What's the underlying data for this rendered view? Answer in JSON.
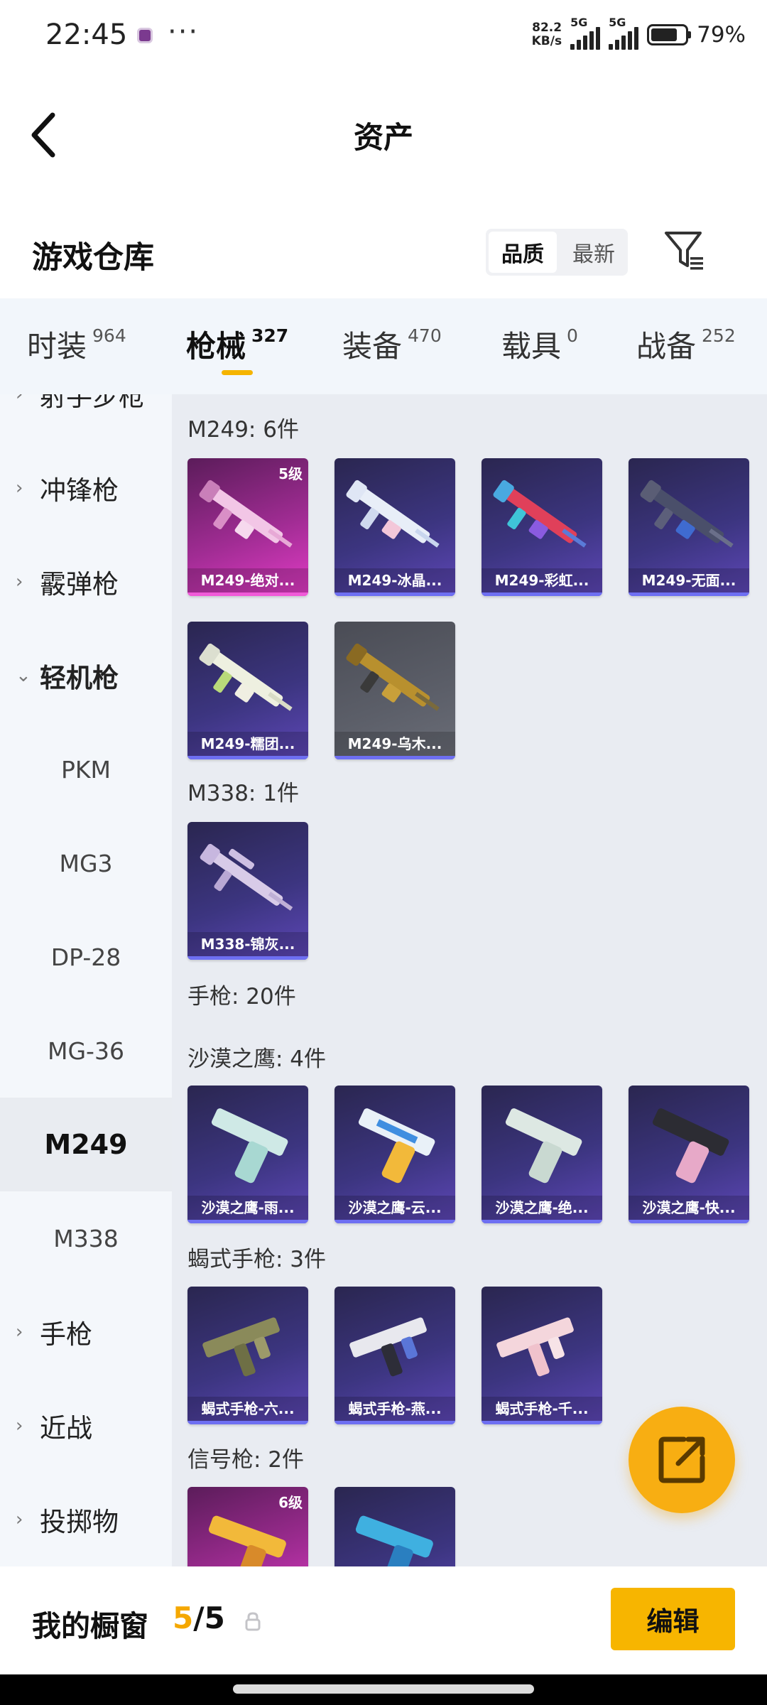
{
  "status_bar": {
    "time": "22:45",
    "speed_value": "82.2",
    "speed_unit": "KB/s",
    "network_1": "5G",
    "network_2": "5G",
    "battery_percent": "79%"
  },
  "header": {
    "title": "资产",
    "back_icon": "back-arrow-icon"
  },
  "warehouse": {
    "title": "游戏仓库",
    "sort_options": [
      "品质",
      "最新"
    ],
    "sort_selected": "品质",
    "filter_icon": "filter-icon"
  },
  "tabs": [
    {
      "name": "时装",
      "count": "964"
    },
    {
      "name": "枪械",
      "count": "327",
      "active": true
    },
    {
      "name": "装备",
      "count": "470"
    },
    {
      "name": "载具",
      "count": "0"
    },
    {
      "name": "战备",
      "count": "252"
    }
  ],
  "sidebar": {
    "partial_item": "射手步枪",
    "items": [
      {
        "label": "冲锋枪",
        "type": "category"
      },
      {
        "label": "霰弹枪",
        "type": "category"
      },
      {
        "label": "轻机枪",
        "type": "category",
        "expanded": true
      },
      {
        "label": "PKM",
        "type": "sub"
      },
      {
        "label": "MG3",
        "type": "sub"
      },
      {
        "label": "DP-28",
        "type": "sub"
      },
      {
        "label": "MG-36",
        "type": "sub"
      },
      {
        "label": "M249",
        "type": "sub",
        "selected": true
      },
      {
        "label": "M338",
        "type": "sub"
      },
      {
        "label": "手枪",
        "type": "category"
      },
      {
        "label": "近战",
        "type": "category"
      },
      {
        "label": "投掷物",
        "type": "category"
      }
    ]
  },
  "groups": {
    "m249": "M249: 6件",
    "m338": "M338: 1件",
    "pistol": "手枪: 20件",
    "deagle": "沙漠之鹰: 4件",
    "scorpion": "蝎式手枪: 3件",
    "flare": "信号枪: 2件"
  },
  "cards": {
    "m249": [
      {
        "name": "M249-绝对...",
        "level": "5级",
        "rarity": "pink"
      },
      {
        "name": "M249-冰晶...",
        "rarity": "purple"
      },
      {
        "name": "M249-彩虹...",
        "rarity": "purple"
      },
      {
        "name": "M249-无面...",
        "rarity": "purple"
      },
      {
        "name": "M249-糯团...",
        "rarity": "purple"
      },
      {
        "name": "M249-乌木...",
        "rarity": "grey"
      }
    ],
    "m338": [
      {
        "name": "M338-锦灰...",
        "rarity": "purple"
      }
    ],
    "deagle": [
      {
        "name": "沙漠之鹰-雨...",
        "rarity": "purple"
      },
      {
        "name": "沙漠之鹰-云...",
        "rarity": "purple"
      },
      {
        "name": "沙漠之鹰-绝...",
        "rarity": "purple"
      },
      {
        "name": "沙漠之鹰-快...",
        "rarity": "purple"
      }
    ],
    "scorpion": [
      {
        "name": "蝎式手枪-六...",
        "rarity": "purple"
      },
      {
        "name": "蝎式手枪-燕...",
        "rarity": "purple"
      },
      {
        "name": "蝎式手枪-千...",
        "rarity": "purple"
      }
    ],
    "flare": [
      {
        "name": "",
        "level": "6级",
        "rarity": "pink"
      },
      {
        "name": "",
        "rarity": "purple"
      }
    ]
  },
  "fab": {
    "icon": "share-external-icon"
  },
  "bottom_bar": {
    "label": "我的橱窗",
    "current": "5",
    "separator": "/",
    "total": "5",
    "lock_icon": "lock-icon",
    "edit_label": "编辑"
  },
  "colors": {
    "accent": "#f7b500",
    "tab_indicator": "#f5b400",
    "purple_card": "#3c3580",
    "pink_card": "#a02c93"
  }
}
